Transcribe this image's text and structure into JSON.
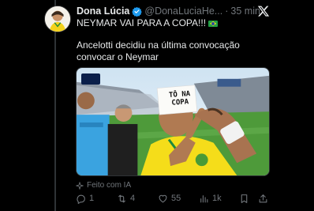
{
  "author": {
    "name": "Dona Lúcia",
    "handle": "@DonaLuciaHe...",
    "separator": "·",
    "time": "35 min"
  },
  "post": {
    "headline": "NEYMAR VAI PARA A COPA!!!",
    "body": "Ancelotti decidiu na última convocação convocar o Neymar",
    "sign_text": "TÔ NA COPA",
    "ai_label": "Feito com IA"
  },
  "actions": {
    "replies": "1",
    "reposts": "4",
    "likes": "55",
    "views": "1k"
  },
  "colors": {
    "background": "#000000",
    "text": "#e7e9ea",
    "muted": "#71767b",
    "verified": "#1d9bf0"
  },
  "icons": [
    "verified-badge-icon",
    "x-logo-icon",
    "brazil-flag-icon",
    "ai-sparkle-icon",
    "reply-icon",
    "repost-icon",
    "like-icon",
    "views-icon",
    "bookmark-icon",
    "share-icon"
  ]
}
